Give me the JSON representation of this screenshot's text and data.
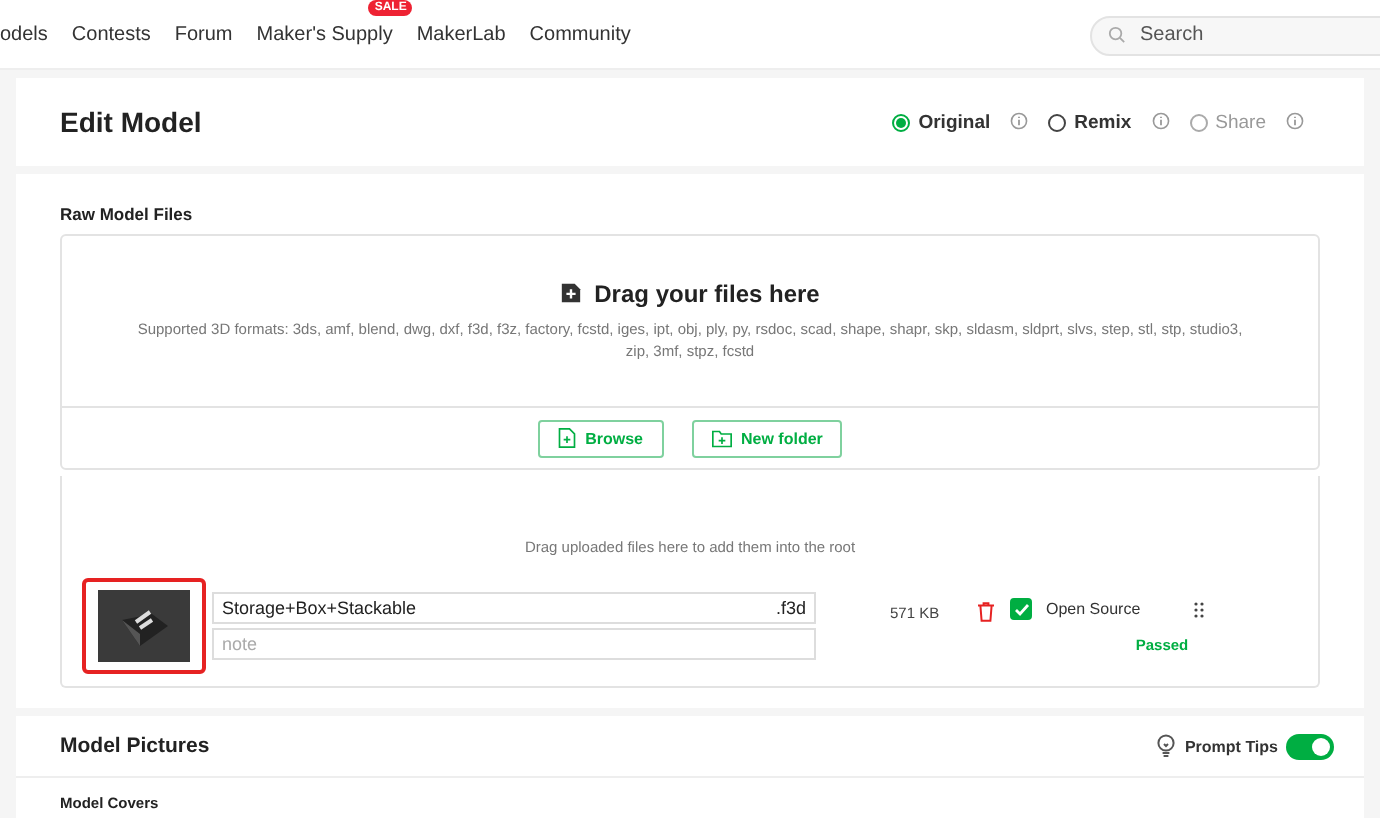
{
  "nav": {
    "items": [
      {
        "label": "odels"
      },
      {
        "label": "Contests"
      },
      {
        "label": "Forum"
      },
      {
        "label": "Maker's Supply",
        "badge": "SALE"
      },
      {
        "label": "MakerLab"
      },
      {
        "label": "Community"
      }
    ],
    "search": {
      "placeholder": "Search"
    }
  },
  "edit": {
    "title": "Edit Model",
    "options": [
      {
        "label": "Original",
        "selected": true,
        "disabled": false
      },
      {
        "label": "Remix",
        "selected": false,
        "disabled": false
      },
      {
        "label": "Share",
        "selected": false,
        "disabled": true
      }
    ]
  },
  "raw_files": {
    "label": "Raw Model Files",
    "dropzone": {
      "title": "Drag your files here",
      "formats": "Supported 3D formats: 3ds, amf, blend, dwg, dxf, f3d, f3z, factory, fcstd, iges, ipt, obj, ply, py, rsdoc, scad, shape, shapr, skp, sldasm, sldprt, slvs, step, stl, stp, studio3, zip, 3mf, stpz, fcstd"
    },
    "buttons": [
      {
        "label": "Browse",
        "kind": "file"
      },
      {
        "label": "New folder",
        "kind": "folder"
      }
    ],
    "root_hint": "Drag uploaded files here to add them into the root",
    "files": [
      {
        "name": "Storage+Box+Stackable",
        "ext": ".f3d",
        "note_placeholder": "note",
        "size": "571 KB",
        "open_source": {
          "label": "Open Source",
          "checked": true
        },
        "status": "Passed",
        "highlighted": true
      }
    ]
  },
  "pictures": {
    "title": "Model Pictures",
    "prompt_tips": {
      "label": "Prompt Tips",
      "on": true
    },
    "subsection": "Model Covers"
  }
}
